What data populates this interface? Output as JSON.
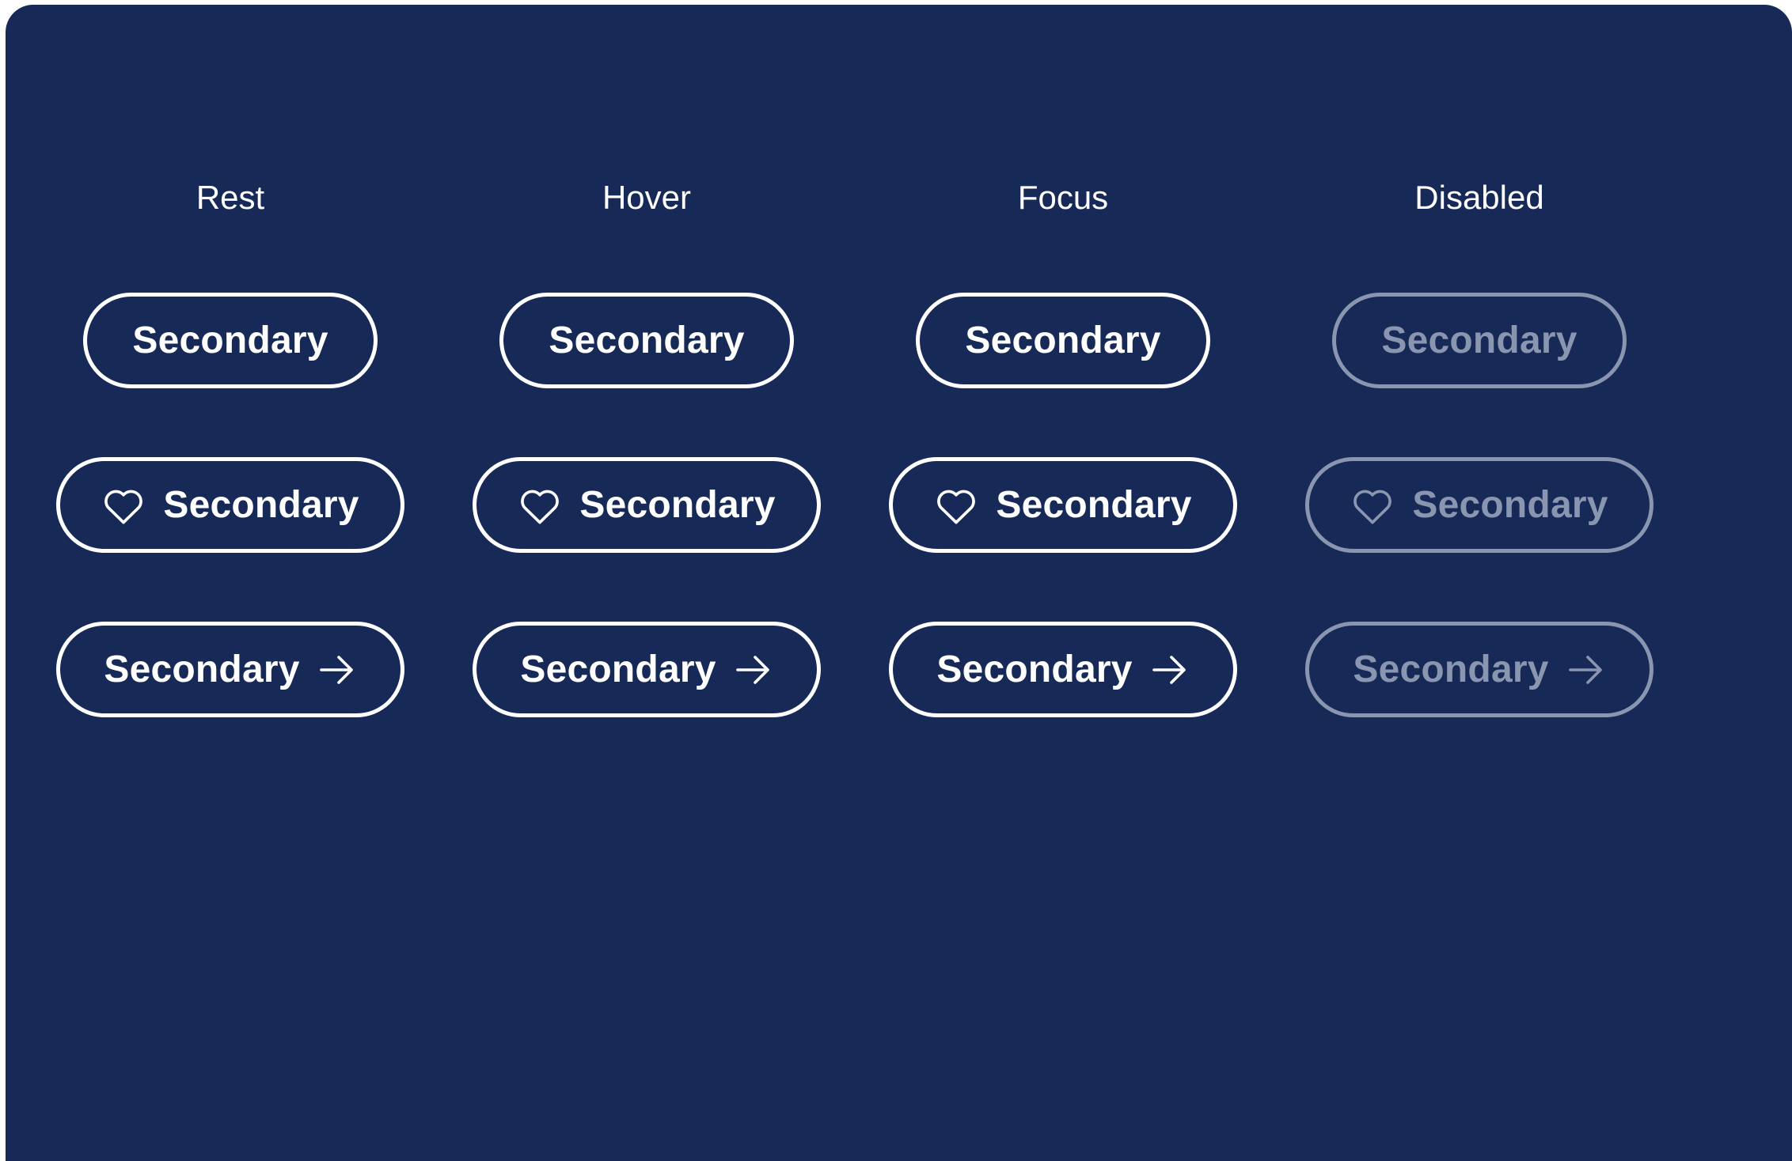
{
  "columns": [
    "Rest",
    "Hover",
    "Focus",
    "Disabled"
  ],
  "button_label": "Secondary",
  "colors": {
    "background": "#162957",
    "button_border": "#ffffff",
    "button_text": "#ffffff",
    "disabled": "#8a95b0"
  },
  "rows": [
    {
      "variant": "text-only",
      "icon": null
    },
    {
      "variant": "leading-icon",
      "icon": "heart-icon"
    },
    {
      "variant": "trailing-icon",
      "icon": "arrow-right-icon"
    }
  ]
}
